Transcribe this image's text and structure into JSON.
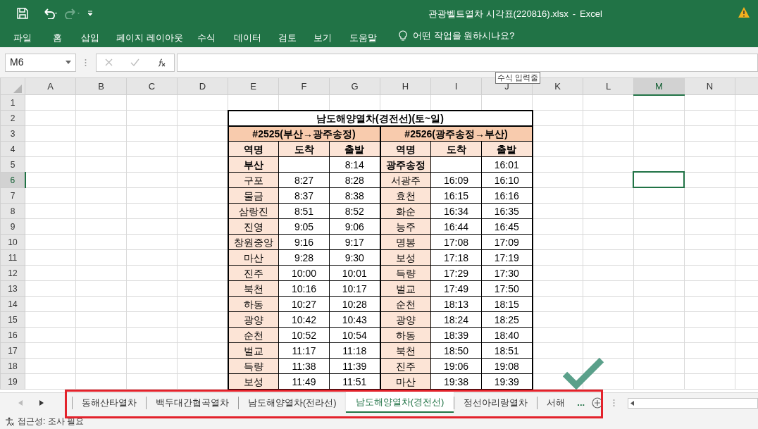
{
  "title_bar": {
    "file": "관광벨트열차 시각표(220816).xlsx",
    "separator": "-",
    "app": "Excel"
  },
  "ribbon": {
    "tabs": [
      "파일",
      "홈",
      "삽입",
      "페이지 레이아웃",
      "수식",
      "데이터",
      "검토",
      "보기",
      "도움말"
    ],
    "tell_me": "어떤 작업을 원하시나요?"
  },
  "name_box": "M6",
  "formula_tooltip": "수식 입력줄",
  "columns": [
    {
      "label": "A",
      "selected": false
    },
    {
      "label": "B",
      "selected": false
    },
    {
      "label": "C",
      "selected": false
    },
    {
      "label": "D",
      "selected": false
    },
    {
      "label": "E",
      "selected": false
    },
    {
      "label": "F",
      "selected": false
    },
    {
      "label": "G",
      "selected": false
    },
    {
      "label": "H",
      "selected": false
    },
    {
      "label": "I",
      "selected": false
    },
    {
      "label": "J",
      "selected": false
    },
    {
      "label": "K",
      "selected": false
    },
    {
      "label": "L",
      "selected": false
    },
    {
      "label": "M",
      "selected": true
    },
    {
      "label": "N",
      "selected": false
    }
  ],
  "rows": [
    {
      "label": "1",
      "selected": false
    },
    {
      "label": "2",
      "selected": false
    },
    {
      "label": "3",
      "selected": false
    },
    {
      "label": "4",
      "selected": false
    },
    {
      "label": "5",
      "selected": false
    },
    {
      "label": "6",
      "selected": true
    },
    {
      "label": "7",
      "selected": false
    },
    {
      "label": "8",
      "selected": false
    },
    {
      "label": "9",
      "selected": false
    },
    {
      "label": "10",
      "selected": false
    },
    {
      "label": "11",
      "selected": false
    },
    {
      "label": "12",
      "selected": false
    },
    {
      "label": "13",
      "selected": false
    },
    {
      "label": "14",
      "selected": false
    },
    {
      "label": "15",
      "selected": false
    },
    {
      "label": "16",
      "selected": false
    },
    {
      "label": "17",
      "selected": false
    },
    {
      "label": "18",
      "selected": false
    },
    {
      "label": "19",
      "selected": false
    }
  ],
  "timetable": {
    "title": "남도해양열차(경전선)(토~일)",
    "directions": [
      "#2525(부산→광주송정)",
      "#2526(광주송정→부산)"
    ],
    "headers": [
      "역명",
      "도착",
      "출발",
      "역명",
      "도착",
      "출발"
    ],
    "rows": [
      {
        "bold": true,
        "cells": [
          "부산",
          "",
          "8:14",
          "광주송정",
          "",
          "16:01"
        ]
      },
      {
        "bold": false,
        "cells": [
          "구포",
          "8:27",
          "8:28",
          "서광주",
          "16:09",
          "16:10"
        ]
      },
      {
        "bold": false,
        "cells": [
          "물금",
          "8:37",
          "8:38",
          "효천",
          "16:15",
          "16:16"
        ]
      },
      {
        "bold": false,
        "cells": [
          "삼랑진",
          "8:51",
          "8:52",
          "화순",
          "16:34",
          "16:35"
        ]
      },
      {
        "bold": false,
        "cells": [
          "진영",
          "9:05",
          "9:06",
          "능주",
          "16:44",
          "16:45"
        ]
      },
      {
        "bold": false,
        "cells": [
          "창원중앙",
          "9:16",
          "9:17",
          "명봉",
          "17:08",
          "17:09"
        ]
      },
      {
        "bold": false,
        "cells": [
          "마산",
          "9:28",
          "9:30",
          "보성",
          "17:18",
          "17:19"
        ]
      },
      {
        "bold": false,
        "cells": [
          "진주",
          "10:00",
          "10:01",
          "득량",
          "17:29",
          "17:30"
        ]
      },
      {
        "bold": false,
        "cells": [
          "북천",
          "10:16",
          "10:17",
          "벌교",
          "17:49",
          "17:50"
        ]
      },
      {
        "bold": false,
        "cells": [
          "하동",
          "10:27",
          "10:28",
          "순천",
          "18:13",
          "18:15"
        ]
      },
      {
        "bold": false,
        "cells": [
          "광양",
          "10:42",
          "10:43",
          "광양",
          "18:24",
          "18:25"
        ]
      },
      {
        "bold": false,
        "cells": [
          "순천",
          "10:52",
          "10:54",
          "하동",
          "18:39",
          "18:40"
        ]
      },
      {
        "bold": false,
        "cells": [
          "벌교",
          "11:17",
          "11:18",
          "북천",
          "18:50",
          "18:51"
        ]
      },
      {
        "bold": false,
        "cells": [
          "득량",
          "11:38",
          "11:39",
          "진주",
          "19:06",
          "19:08"
        ]
      },
      {
        "bold": false,
        "cells": [
          "보성",
          "11:49",
          "11:51",
          "마산",
          "19:38",
          "19:39"
        ]
      }
    ]
  },
  "sheet_tabs": [
    {
      "label": "동해산타열차",
      "selected": false
    },
    {
      "label": "백두대간협곡열차",
      "selected": false
    },
    {
      "label": "남도해양열차(전라선)",
      "selected": false
    },
    {
      "label": "남도해양열차(경전선)",
      "selected": true
    },
    {
      "label": "정선아리랑열차",
      "selected": false
    },
    {
      "label": "서해",
      "selected": false
    }
  ],
  "more_tabs": "...",
  "status": "접근성: 조사 필요"
}
